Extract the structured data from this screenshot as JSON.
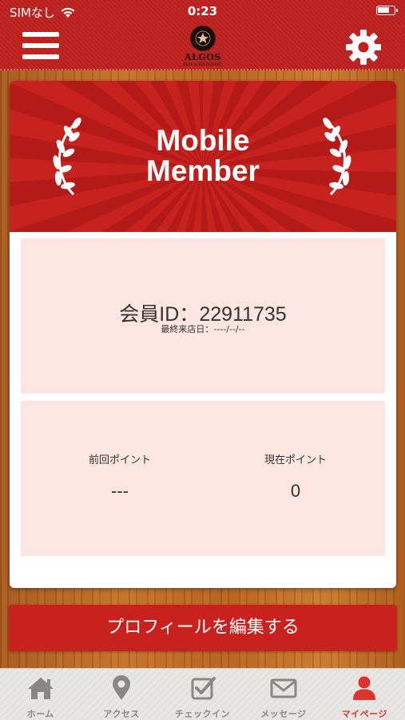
{
  "status_bar": {
    "carrier": "SIMなし",
    "time": "0:23"
  },
  "header": {
    "logo_text": "ALGOS",
    "logo_subtext": "BEER & RESTAURANT"
  },
  "banner": {
    "title_line1": "Mobile",
    "title_line2": "Member"
  },
  "member": {
    "id_label": "会員ID：",
    "id_value": "22911735",
    "last_visit_label": "最終来店日：",
    "last_visit_value": "----/--/--"
  },
  "points": {
    "previous_label": "前回ポイント",
    "previous_value": "---",
    "current_label": "現在ポイント",
    "current_value": "0"
  },
  "edit_profile_label": "プロフィールを編集する",
  "tabs": [
    {
      "label": "ホーム",
      "icon": "home-icon",
      "active": false
    },
    {
      "label": "アクセス",
      "icon": "map-pin-icon",
      "active": false
    },
    {
      "label": "チェックイン",
      "icon": "checkbox-icon",
      "active": false
    },
    {
      "label": "メッセージ",
      "icon": "envelope-icon",
      "active": false
    },
    {
      "label": "マイページ",
      "icon": "person-icon",
      "active": true
    }
  ],
  "colors": {
    "header_red": "#c0211e",
    "accent_red": "#c8211e",
    "panel_pink": "#fde5e3",
    "tab_active": "#e0322c",
    "tab_inactive": "#8a8684"
  }
}
